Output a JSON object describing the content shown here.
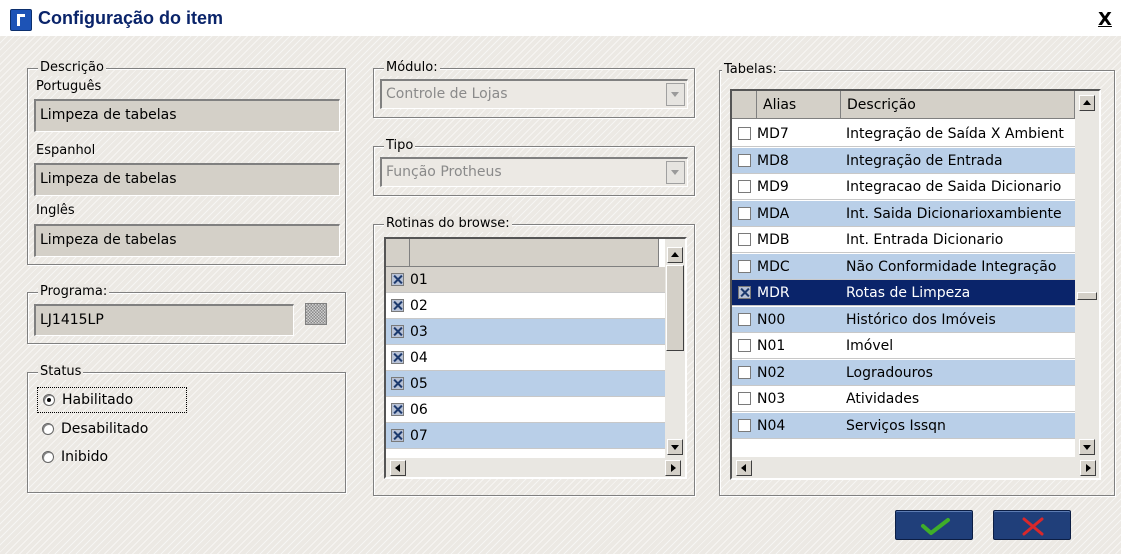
{
  "window": {
    "title": "Configuração do item",
    "close_label": "X"
  },
  "descricao": {
    "legend": "Descrição",
    "portugues_label": "Português",
    "portugues_value": "Limpeza de tabelas",
    "espanhol_label": "Espanhol",
    "espanhol_value": "Limpeza de tabelas",
    "ingles_label": "Inglês",
    "ingles_value": "Limpeza de tabelas"
  },
  "programa": {
    "legend": "Programa:",
    "value": "LJ1415LP"
  },
  "status": {
    "legend": "Status",
    "options": [
      {
        "label": "Habilitado",
        "selected": true
      },
      {
        "label": "Desabilitado",
        "selected": false
      },
      {
        "label": "Inibido",
        "selected": false
      }
    ]
  },
  "modulo": {
    "legend": "Módulo:",
    "value": "Controle de Lojas"
  },
  "tipo": {
    "legend": "Tipo",
    "value": "Função Protheus"
  },
  "rotinas": {
    "legend": "Rotinas do browse:",
    "rows": [
      {
        "label": "01",
        "checked": true
      },
      {
        "label": "02",
        "checked": true
      },
      {
        "label": "03",
        "checked": true
      },
      {
        "label": "04",
        "checked": true
      },
      {
        "label": "05",
        "checked": true
      },
      {
        "label": "06",
        "checked": true
      },
      {
        "label": "07",
        "checked": true
      }
    ]
  },
  "tabelas": {
    "legend": "Tabelas:",
    "columns": [
      "Alias",
      "Descrição"
    ],
    "rows": [
      {
        "alias": "MD7",
        "descricao": "Integração de Saída X Ambient",
        "checked": false
      },
      {
        "alias": "MD8",
        "descricao": "Integração de Entrada",
        "checked": false
      },
      {
        "alias": "MD9",
        "descricao": "Integracao de Saida Dicionario",
        "checked": false
      },
      {
        "alias": "MDA",
        "descricao": "Int. Saida Dicionarioxambiente",
        "checked": false
      },
      {
        "alias": "MDB",
        "descricao": "Int. Entrada Dicionario",
        "checked": false
      },
      {
        "alias": "MDC",
        "descricao": "Não Conformidade Integração",
        "checked": false
      },
      {
        "alias": "MDR",
        "descricao": "Rotas de Limpeza",
        "checked": true,
        "selected": true
      },
      {
        "alias": "N00",
        "descricao": "Histórico dos Imóveis",
        "checked": false
      },
      {
        "alias": "N01",
        "descricao": "Imóvel",
        "checked": false
      },
      {
        "alias": "N02",
        "descricao": "Logradouros",
        "checked": false
      },
      {
        "alias": "N03",
        "descricao": "Atividades",
        "checked": false
      },
      {
        "alias": "N04",
        "descricao": "Serviços Issqn",
        "checked": false
      }
    ]
  },
  "icons": {
    "confirm": "checkmark-icon",
    "cancel": "cross-icon"
  },
  "colors": {
    "selection": "#0a246a",
    "row_alt": "#b9cfe8",
    "confirm": "#3fae29",
    "cancel": "#d9282b"
  }
}
